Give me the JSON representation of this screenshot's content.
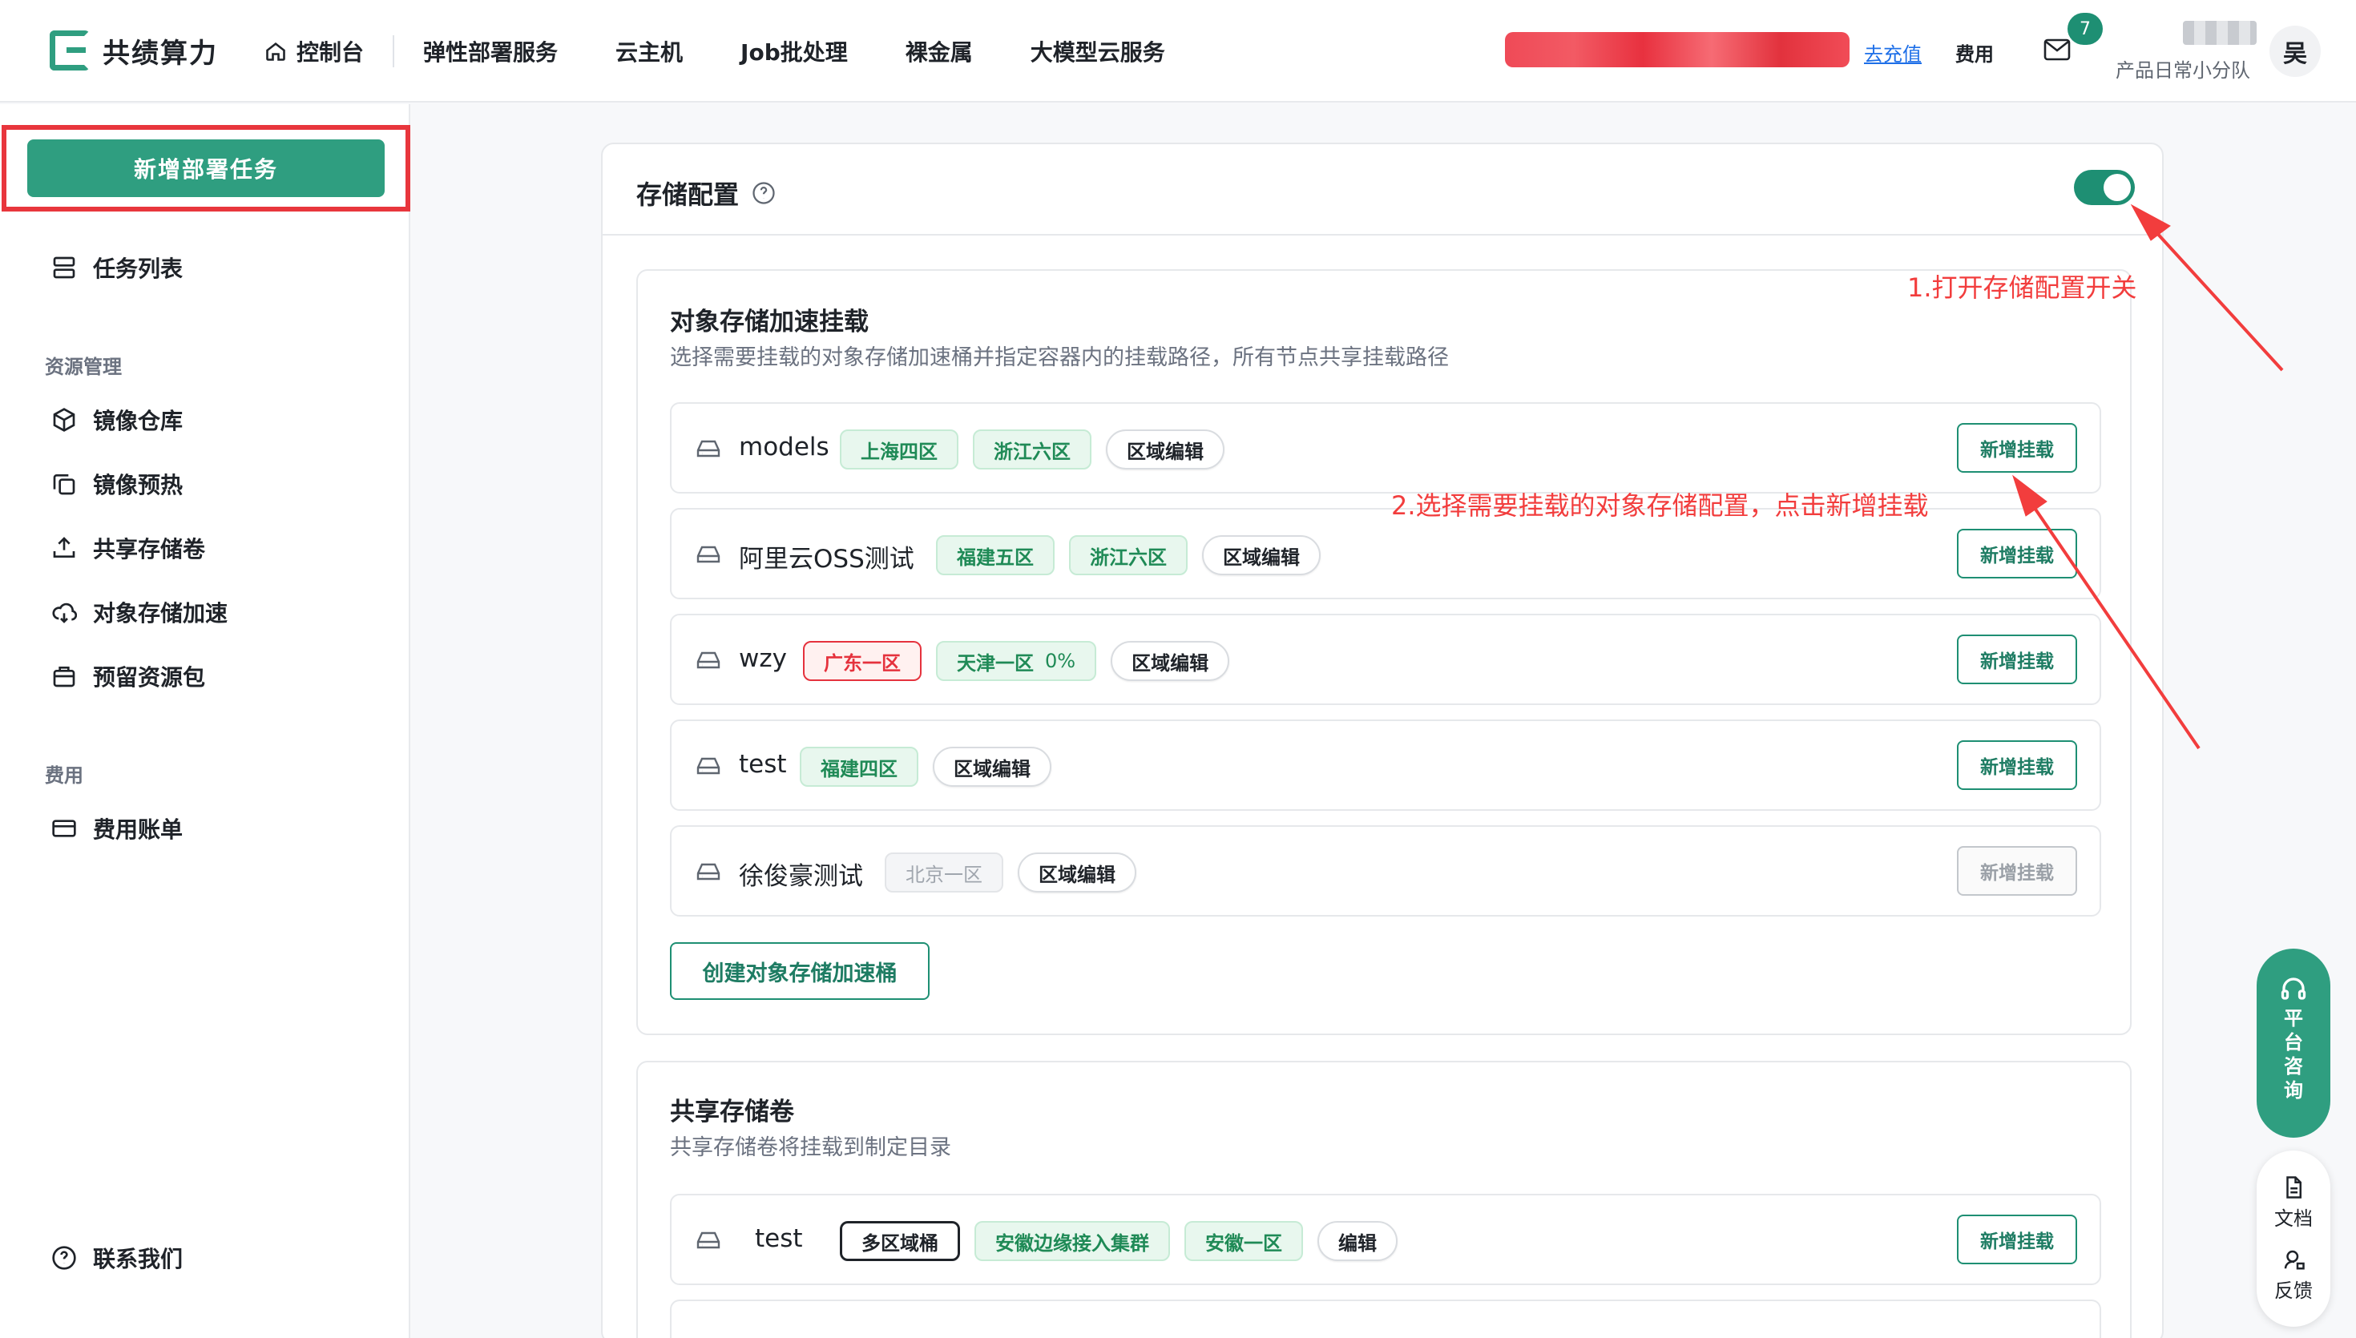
{
  "header": {
    "logo_text": "共绩算力",
    "nav": [
      "控制台",
      "弹性部署服务",
      "云主机",
      "Job批处理",
      "裸金属",
      "大模型云服务"
    ],
    "recharge": "去充值",
    "fee": "费用",
    "mail_count": "7",
    "team": "产品日常小分队",
    "avatar": "吴"
  },
  "sidebar": {
    "new_task": "新增部署任务",
    "task_list": "任务列表",
    "group_resources": "资源管理",
    "items": [
      "镜像仓库",
      "镜像预热",
      "共享存储卷",
      "对象存储加速",
      "预留资源包"
    ],
    "group_fee": "费用",
    "bill": "费用账单",
    "contact": "联系我们"
  },
  "main": {
    "title": "存储配置",
    "toggle_on": true,
    "object_section": {
      "title": "对象存储加速挂载",
      "desc": "选择需要挂载的对象存储加速桶并指定容器内的挂载路径，所有节点共享挂载路径",
      "rows": [
        {
          "name": "models",
          "tags": [
            {
              "text": "上海四区",
              "style": "green"
            },
            {
              "text": "浙江六区",
              "style": "green"
            }
          ],
          "edit": "区域编辑",
          "mount": "新增挂载",
          "disabled": false
        },
        {
          "name": "阿里云OSS测试",
          "tags": [
            {
              "text": "福建五区",
              "style": "green"
            },
            {
              "text": "浙江六区",
              "style": "green"
            }
          ],
          "edit": "区域编辑",
          "mount": "新增挂载",
          "disabled": false
        },
        {
          "name": "wzy",
          "tags": [
            {
              "text": "广东一区",
              "style": "red"
            },
            {
              "text": "天津一区",
              "style": "green",
              "pct": "0%"
            }
          ],
          "edit": "区域编辑",
          "mount": "新增挂载",
          "disabled": false
        },
        {
          "name": "test",
          "tags": [
            {
              "text": "福建四区",
              "style": "green"
            }
          ],
          "edit": "区域编辑",
          "mount": "新增挂载",
          "disabled": false
        },
        {
          "name": "徐俊豪测试",
          "tags": [
            {
              "text": "北京一区",
              "style": "gray"
            }
          ],
          "edit": "区域编辑",
          "mount": "新增挂载",
          "disabled": true
        }
      ],
      "create": "创建对象存储加速桶"
    },
    "shared_section": {
      "title": "共享存储卷",
      "desc": "共享存储卷将挂载到制定目录",
      "rows": [
        {
          "name": "test",
          "tags": [
            {
              "text": "多区域桶",
              "style": "outline"
            },
            {
              "text": "安徽边缘接入集群",
              "style": "green"
            },
            {
              "text": "安徽一区",
              "style": "green"
            }
          ],
          "edit": "编辑",
          "mount": "新增挂载"
        }
      ]
    }
  },
  "annotations": {
    "step1": "1.打开存储配置开关",
    "step2": "2.选择需要挂载的对象存储配置，点击新增挂载"
  },
  "float": {
    "consult": [
      "平",
      "台",
      "咨",
      "询"
    ],
    "docs": "文档",
    "feedback": "反馈"
  },
  "colors": {
    "brand": "#2f9e80",
    "annotation": "#f23d3d"
  }
}
